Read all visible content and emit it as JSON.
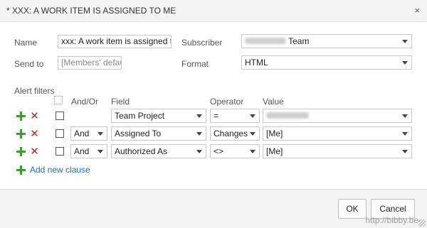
{
  "dialog": {
    "title": "* XXX: A WORK ITEM IS ASSIGNED TO ME",
    "close_glyph": "×"
  },
  "form": {
    "name_label": "Name",
    "name_value": "xxx: A work item is assigned to",
    "sendto_label": "Send to",
    "sendto_placeholder": "[Members' defau",
    "subscriber_label": "Subscriber",
    "subscriber_value": "Team",
    "format_label": "Format",
    "format_value": "HTML"
  },
  "filters": {
    "section_label": "Alert filters",
    "headers": {
      "andor": "And/Or",
      "field": "Field",
      "operator": "Operator",
      "value": "Value"
    },
    "rows": [
      {
        "andor": "",
        "field": "Team Project",
        "operator": "=",
        "value": ""
      },
      {
        "andor": "And",
        "field": "Assigned To",
        "operator": "Changes",
        "value": "[Me]"
      },
      {
        "andor": "And",
        "field": "Authorized As",
        "operator": "<>",
        "value": "[Me]"
      }
    ],
    "add_clause": "Add new clause"
  },
  "footer": {
    "ok_label": "OK",
    "cancel_label": "Cancel",
    "watermark": "http://bibby.be"
  },
  "icons": {
    "add": "plus-icon",
    "delete": "red-x-icon",
    "close": "close-icon",
    "group": "group-clauses-icon"
  },
  "colors": {
    "add_green": "#3e9b2e",
    "delete_red": "#c0281c",
    "link_blue": "#1f6fb3"
  }
}
